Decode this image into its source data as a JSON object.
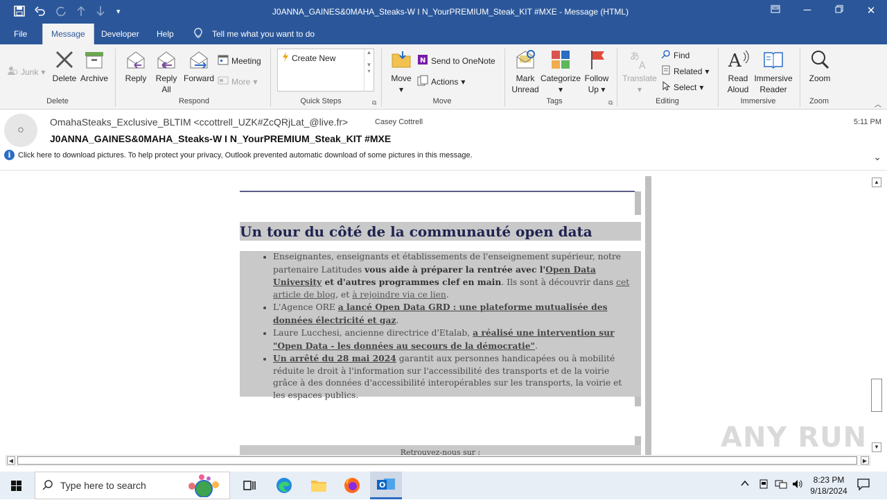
{
  "window": {
    "title": "J0ANNA_GAINES&0MAHA_Steaks-W I N_YourPREMIUM_Steak_KIT #MXE  -  Message (HTML)"
  },
  "menu": {
    "items": [
      "File",
      "Message",
      "Developer",
      "Help"
    ],
    "tell_me": "Tell me what you want to do",
    "active": "Message"
  },
  "ribbon": {
    "junk": "Junk",
    "delete": "Delete",
    "archive": "Archive",
    "reply": "Reply",
    "reply_all_1": "Reply",
    "reply_all_2": "All",
    "forward": "Forward",
    "meeting": "Meeting",
    "more": "More",
    "create_new": "Create New",
    "move": "Move",
    "send_onenote": "Send to OneNote",
    "actions": "Actions",
    "mark_unread_1": "Mark",
    "mark_unread_2": "Unread",
    "categorize": "Categorize",
    "follow_up_1": "Follow",
    "follow_up_2": "Up",
    "translate": "Translate",
    "find": "Find",
    "related": "Related",
    "select": "Select",
    "read_aloud_1": "Read",
    "read_aloud_2": "Aloud",
    "immersive_1": "Immersive",
    "immersive_2": "Reader",
    "zoom": "Zoom",
    "groups": {
      "delete": "Delete",
      "respond": "Respond",
      "quick_steps": "Quick Steps",
      "move": "Move",
      "tags": "Tags",
      "editing": "Editing",
      "immersive": "Immersive",
      "zoom": "Zoom"
    }
  },
  "message": {
    "sender": "OmahaSteaks_Exclusive_BLTIM <ccottrell_UZK#ZcQRjLat_@live.fr>",
    "recipient": "Casey Cottrell",
    "time": "5:11 PM",
    "subject": "J0ANNA_GAINES&0MAHA_Steaks-W I N_YourPREMIUM_Steak_KIT  #MXE",
    "info": "Click here to download pictures. To help protect your privacy, Outlook prevented automatic download of some pictures in this message."
  },
  "newsletter": {
    "heading": "Un tour du côté de la communauté open data",
    "item1_a": "Enseignantes, enseignants et établissements de l'enseignement supérieur, notre partenaire Latitudes ",
    "item1_b": "vous aide à préparer la rentrée avec l'",
    "item1_link1": "Open Data University",
    "item1_c": " et d'autres programmes clef en main",
    "item1_d": ". Ils sont à découvrir dans ",
    "item1_link2": "cet article de blog",
    "item1_e": ", et ",
    "item1_link3": "à rejoindre via ce lien",
    "item1_f": ".",
    "item2_a": "L'Agence ORE ",
    "item2_link": "a lancé Open Data GRD : une plateforme mutualisée des données électricité et gaz",
    "item2_b": ".",
    "item3_a": "Laure Lucchesi, ancienne directrice d'Etalab, ",
    "item3_link": "a réalisé une intervention sur \"Open Data - les données au secours de la démocratie\"",
    "item3_b": ".",
    "item4_link": "Un arrêté du 28 mai 2024",
    "item4_a": " garantit aux personnes handicapées ou à mobilité réduite le droit à l'information sur l'accessibilité des transports et de la voirie grâce à des données d'accessibilité interopérables sur les transports, la voirie et les espaces publics.",
    "retrouvez": "Retrouvez-nous sur :"
  },
  "taskbar": {
    "search_placeholder": "Type here to search",
    "time": "8:23 PM",
    "date": "9/18/2024"
  },
  "watermark": "ANY RUN"
}
